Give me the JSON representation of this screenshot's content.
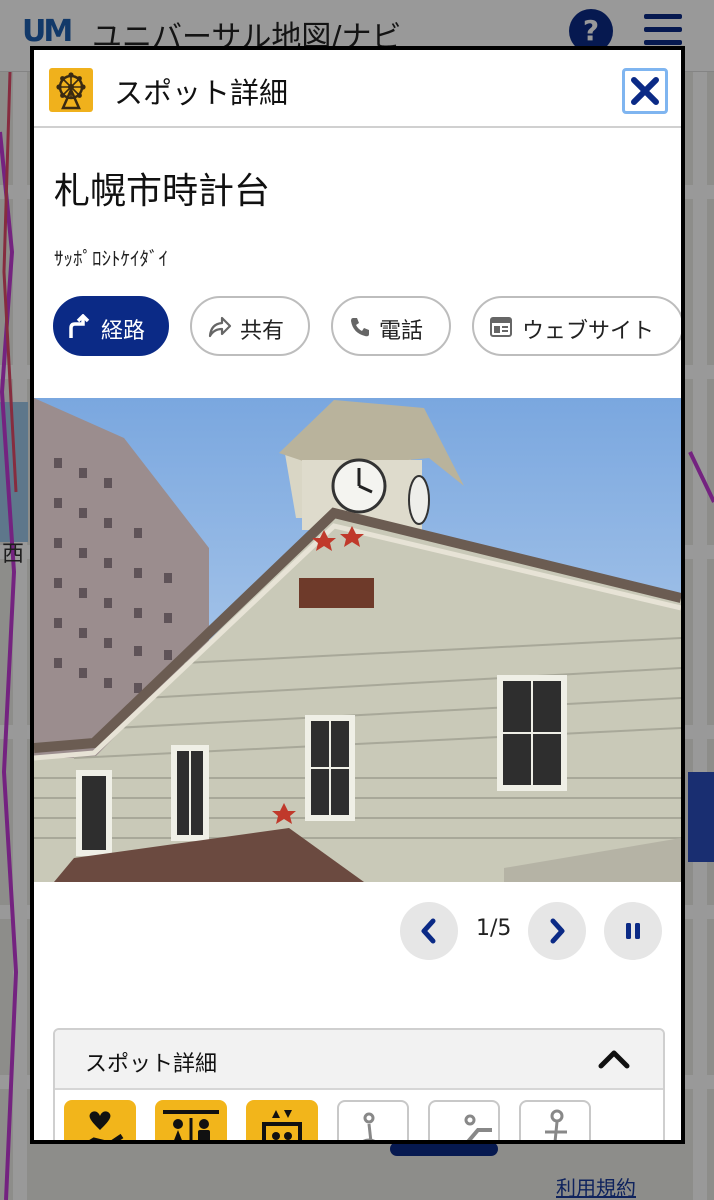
{
  "app": {
    "logo": "UM",
    "title": "ユニバーサル地図/ナビ",
    "help_label": "?",
    "terms_link": "利用規約"
  },
  "modal": {
    "header_title": "スポット詳細",
    "spot_name": "札幌市時計台",
    "spot_kana": "ｻｯﾎﾟﾛｼﾄｹｲﾀﾞｲ",
    "actions": [
      {
        "label": "経路",
        "icon": "route-icon"
      },
      {
        "label": "共有",
        "icon": "share-icon"
      },
      {
        "label": "電話",
        "icon": "phone-icon"
      },
      {
        "label": "ウェブサイト",
        "icon": "website-icon"
      }
    ],
    "gallery": {
      "counter": "1/5",
      "image_subject": "Sapporo Clock Tower photo"
    },
    "details": {
      "title": "スポット詳細",
      "facilities": [
        {
          "icon": "accessible-service-icon",
          "active": true
        },
        {
          "icon": "restroom-icon",
          "active": true
        },
        {
          "icon": "elevator-icon",
          "active": true
        },
        {
          "icon": "wheelchair-icon",
          "active": false
        },
        {
          "icon": "escalator-icon",
          "active": false
        },
        {
          "icon": "walking-person-icon",
          "active": false
        }
      ]
    }
  },
  "colors": {
    "primary": "#0b2a86",
    "accent_yellow": "#f2b51b",
    "close_border": "#7fb5f0"
  }
}
